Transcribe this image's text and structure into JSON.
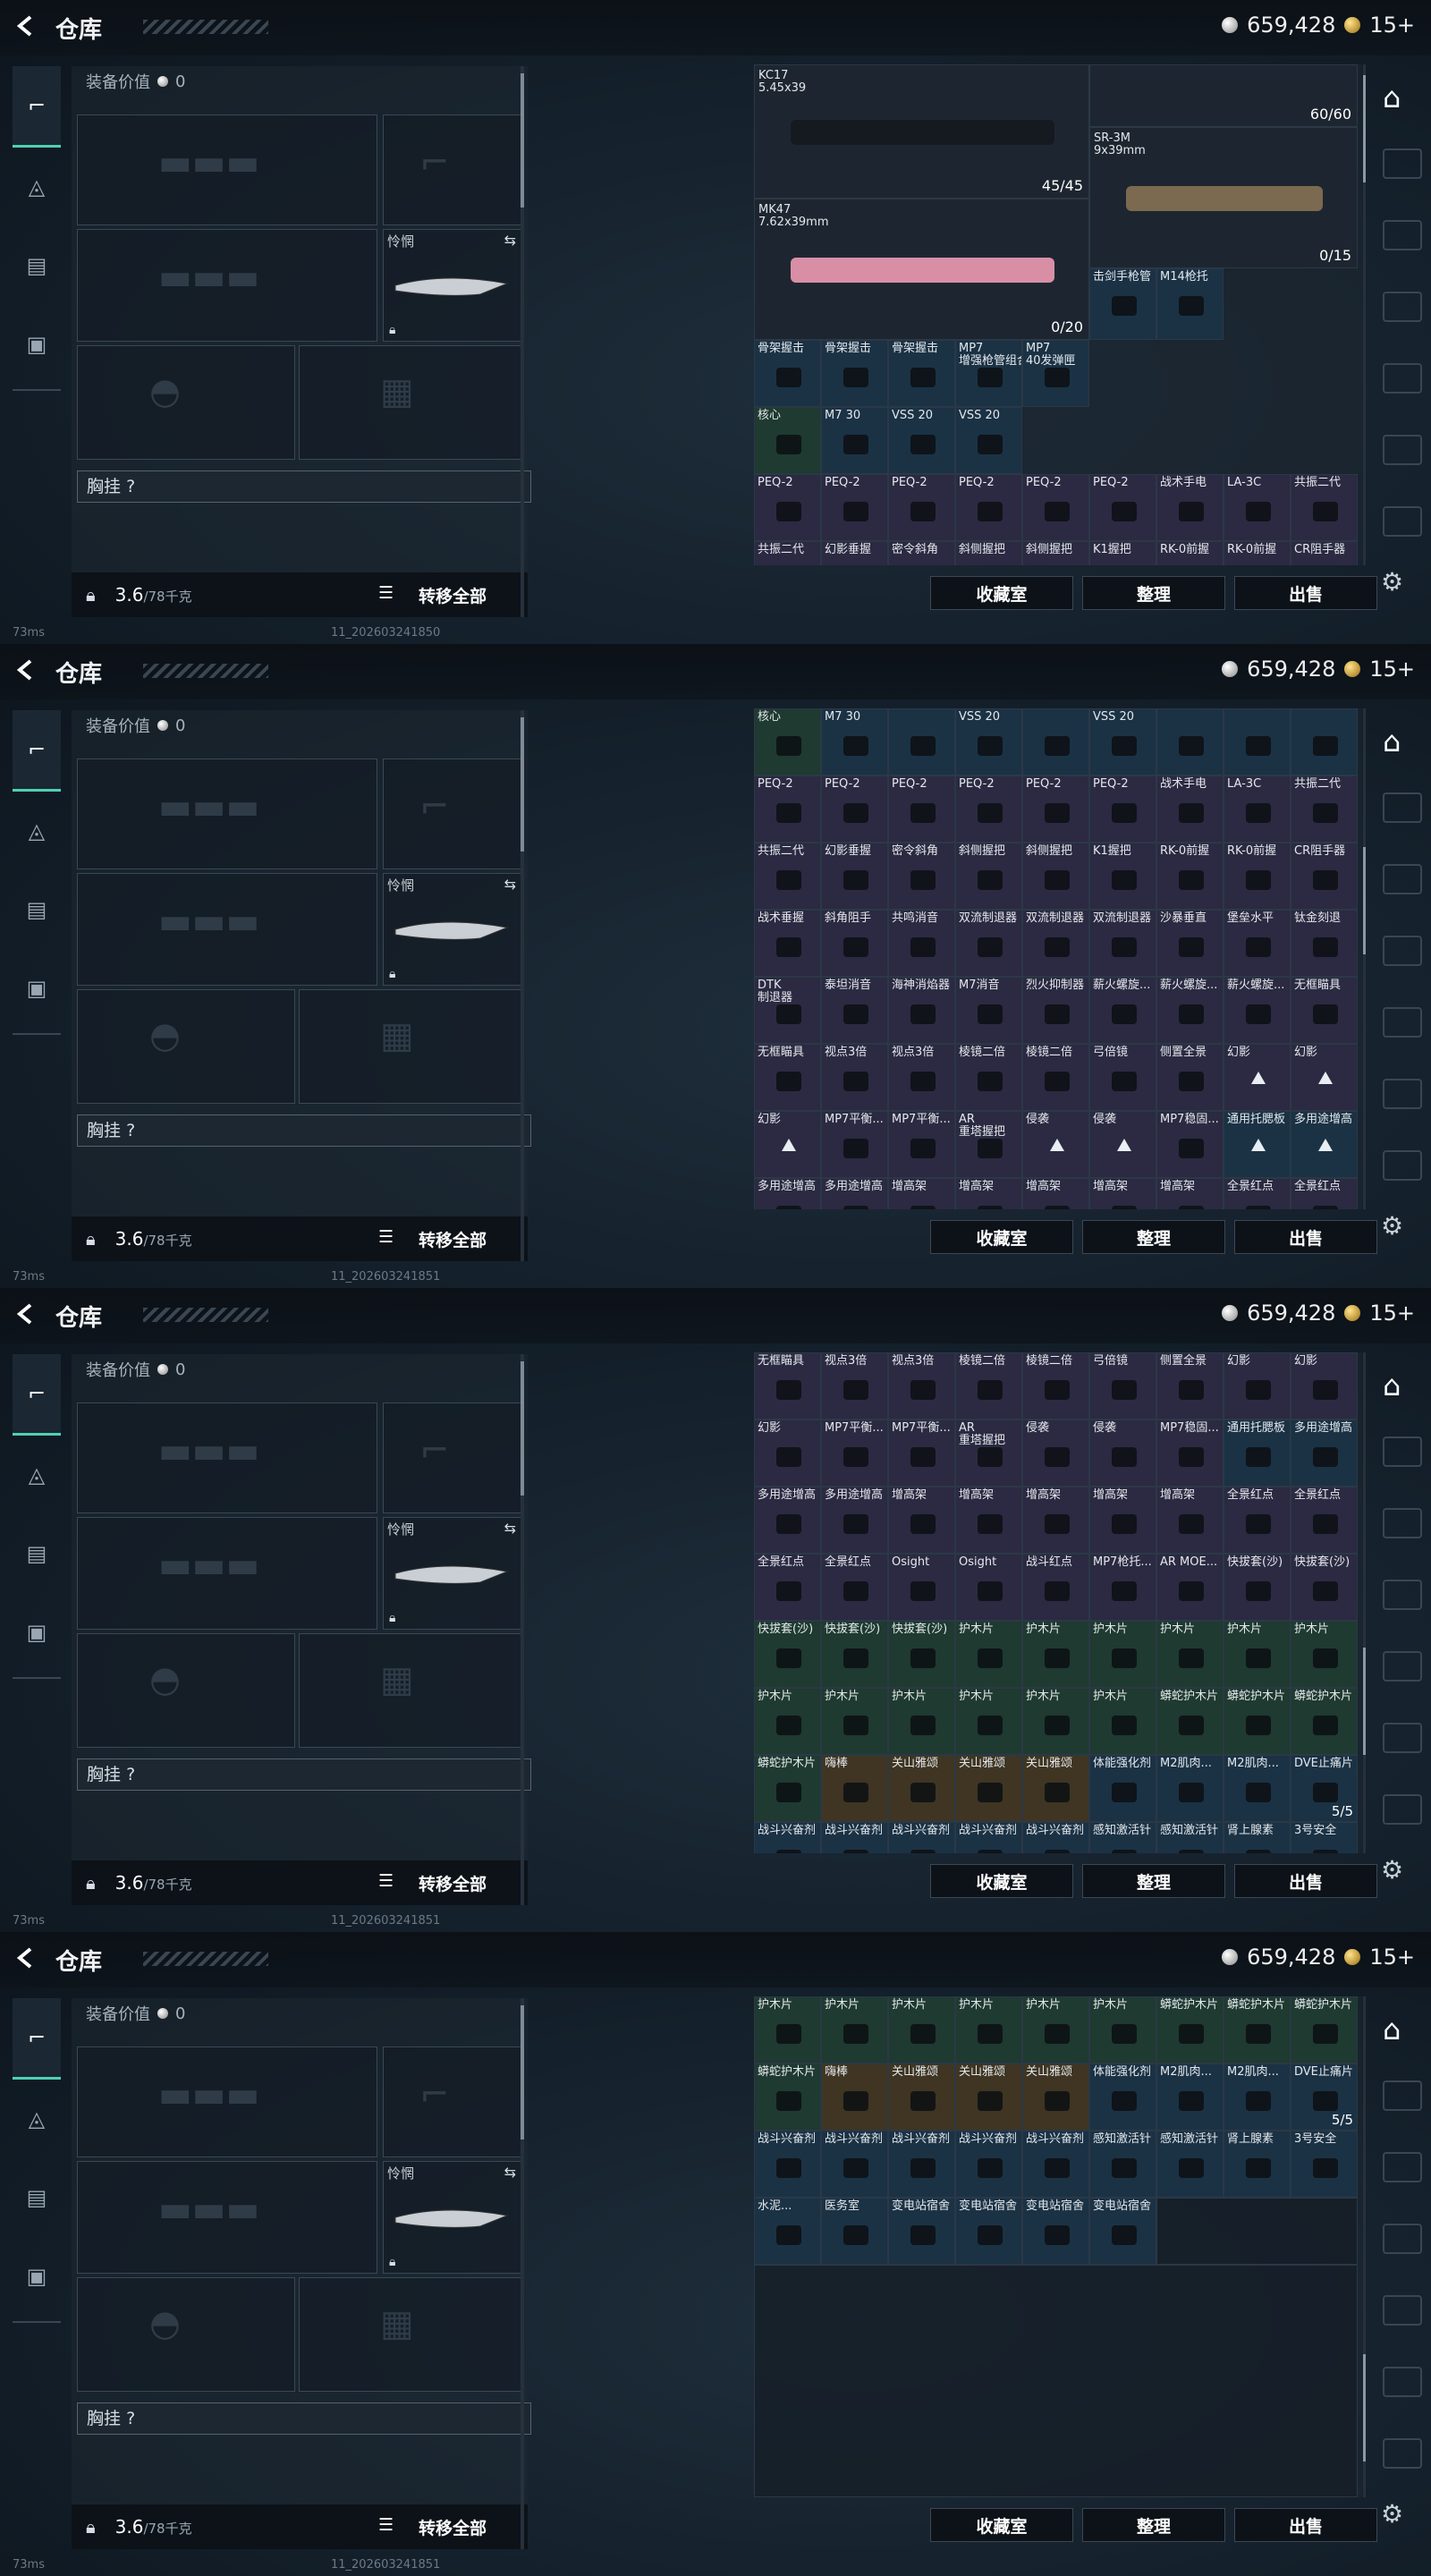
{
  "header": {
    "title": "仓库",
    "silver": "659,428",
    "gold": "15+"
  },
  "equipment": {
    "value_label": "装备价值",
    "value": "0",
    "melee_label": "怜惘",
    "chest_label": "胸挂",
    "chest_hint": "?",
    "weight": "3.6",
    "weight_max": "/78千克",
    "transfer_all": "转移全部"
  },
  "actions": {
    "collection": "收藏室",
    "sort": "整理",
    "sell": "出售"
  },
  "status": {
    "ping": "73ms",
    "build1": "11_202603241850",
    "build2": "11_202603241851"
  },
  "panel1": {
    "weapons": {
      "kc17": {
        "name": "KC17",
        "caliber": "5.45x39",
        "ammo": "45/45"
      },
      "mk47": {
        "name": "MK47",
        "caliber": "7.62x39mm",
        "ammo": "0/20"
      },
      "sr3m": {
        "name": "SR-3M",
        "caliber": "9x39mm",
        "ammo": "0/15"
      },
      "grenade": {
        "ammo": "60/60"
      }
    },
    "rows": [
      [
        {
          "n": "击剑手枪管",
          "c": "b"
        },
        {
          "n": "M14枪托",
          "c": "b"
        }
      ],
      [
        {
          "n": "骨架握击",
          "c": "b"
        },
        {
          "n": "骨架握击",
          "c": "b"
        },
        {
          "n": "骨架握击",
          "c": "b"
        },
        {
          "n": "MP7\n增强枪管组合",
          "c": "b"
        },
        {
          "n": "MP7\n40发弹匣",
          "c": "b"
        }
      ],
      [
        {
          "n": "核心",
          "c": "g"
        },
        {
          "n": "M7 30",
          "c": "b"
        },
        {
          "n": "VSS 20",
          "c": "b"
        },
        {
          "n": "VSS 20",
          "c": "b"
        }
      ],
      [
        {
          "n": "PEQ-2",
          "c": "p"
        },
        {
          "n": "PEQ-2",
          "c": "p"
        },
        {
          "n": "PEQ-2",
          "c": "p"
        },
        {
          "n": "PEQ-2",
          "c": "p"
        },
        {
          "n": "PEQ-2",
          "c": "p"
        },
        {
          "n": "PEQ-2",
          "c": "p"
        },
        {
          "n": "战术手电",
          "c": "p"
        },
        {
          "n": "LA-3C",
          "c": "p"
        },
        {
          "n": "共振二代",
          "c": "p"
        }
      ],
      [
        {
          "n": "共振二代",
          "c": "p"
        },
        {
          "n": "幻影垂握",
          "c": "p"
        },
        {
          "n": "密令斜角",
          "c": "p"
        },
        {
          "n": "斜侧握把",
          "c": "p"
        },
        {
          "n": "斜侧握把",
          "c": "p"
        },
        {
          "n": "K1握把",
          "c": "p"
        },
        {
          "n": "RK-0前握",
          "c": "p"
        },
        {
          "n": "RK-0前握",
          "c": "p"
        },
        {
          "n": "CR阻手器",
          "c": "p"
        }
      ]
    ]
  },
  "panel2": {
    "rows": [
      [
        {
          "n": "核心",
          "c": "g"
        },
        {
          "n": "M7 30",
          "c": "b"
        },
        {
          "n": "",
          "c": "b"
        },
        {
          "n": "VSS 20",
          "c": "b"
        },
        {
          "n": "",
          "c": "b"
        },
        {
          "n": "VSS 20",
          "c": "b"
        },
        {
          "n": "",
          "c": "b"
        },
        {
          "n": "",
          "c": "b"
        },
        {
          "n": "",
          "c": "b"
        }
      ],
      [
        {
          "n": "PEQ-2",
          "c": "p"
        },
        {
          "n": "PEQ-2",
          "c": "p"
        },
        {
          "n": "PEQ-2",
          "c": "p"
        },
        {
          "n": "PEQ-2",
          "c": "p"
        },
        {
          "n": "PEQ-2",
          "c": "p"
        },
        {
          "n": "PEQ-2",
          "c": "p"
        },
        {
          "n": "战术手电",
          "c": "p"
        },
        {
          "n": "LA-3C",
          "c": "p"
        },
        {
          "n": "共振二代",
          "c": "p"
        }
      ],
      [
        {
          "n": "共振二代",
          "c": "p"
        },
        {
          "n": "幻影垂握",
          "c": "p"
        },
        {
          "n": "密令斜角",
          "c": "p"
        },
        {
          "n": "斜侧握把",
          "c": "p"
        },
        {
          "n": "斜侧握把",
          "c": "p"
        },
        {
          "n": "K1握把",
          "c": "p"
        },
        {
          "n": "RK-0前握",
          "c": "p"
        },
        {
          "n": "RK-0前握",
          "c": "p"
        },
        {
          "n": "CR阻手器",
          "c": "p"
        }
      ],
      [
        {
          "n": "战术垂握",
          "c": "p"
        },
        {
          "n": "斜角阻手",
          "c": "p"
        },
        {
          "n": "共鸣消音",
          "c": "p"
        },
        {
          "n": "双流制退器",
          "c": "p"
        },
        {
          "n": "双流制退器",
          "c": "p"
        },
        {
          "n": "双流制退器",
          "c": "p"
        },
        {
          "n": "沙暴垂直",
          "c": "p"
        },
        {
          "n": "堡垒水平",
          "c": "p"
        },
        {
          "n": "钛金刻退",
          "c": "p"
        }
      ],
      [
        {
          "n": "DTK\n制退器",
          "c": "p"
        },
        {
          "n": "泰坦消音",
          "c": "p"
        },
        {
          "n": "海神消焰器",
          "c": "p"
        },
        {
          "n": "M7消音",
          "c": "p"
        },
        {
          "n": "烈火抑制器",
          "c": "p"
        },
        {
          "n": "薪火螺旋...",
          "c": "p"
        },
        {
          "n": "薪火螺旋...",
          "c": "p"
        },
        {
          "n": "薪火螺旋...",
          "c": "p"
        },
        {
          "n": "无框瞄具",
          "c": "p"
        }
      ],
      [
        {
          "n": "无框瞄具",
          "c": "p"
        },
        {
          "n": "视点3倍",
          "c": "p"
        },
        {
          "n": "视点3倍",
          "c": "p"
        },
        {
          "n": "棱镜二倍",
          "c": "p"
        },
        {
          "n": "棱镜二倍",
          "c": "p"
        },
        {
          "n": "弓倍镜",
          "c": "p"
        },
        {
          "n": "侧置全景",
          "c": "p"
        },
        {
          "n": "幻影",
          "c": "p",
          "t": 1
        },
        {
          "n": "幻影",
          "c": "p",
          "t": 1
        }
      ],
      [
        {
          "n": "幻影",
          "c": "p",
          "t": 1
        },
        {
          "n": "MP7平衡...",
          "c": "p"
        },
        {
          "n": "MP7平衡...",
          "c": "p"
        },
        {
          "n": "AR\n重塔握把",
          "c": "p"
        },
        {
          "n": "侵袭",
          "c": "p",
          "t": 1
        },
        {
          "n": "侵袭",
          "c": "p",
          "t": 1
        },
        {
          "n": "MP7稳固...",
          "c": "p"
        },
        {
          "n": "通用托腮板",
          "c": "b",
          "t": 1
        },
        {
          "n": "多用途增高",
          "c": "b",
          "t": 1
        }
      ],
      [
        {
          "n": "多用途增高",
          "c": "p"
        },
        {
          "n": "多用途增高",
          "c": "p"
        },
        {
          "n": "增高架",
          "c": "p"
        },
        {
          "n": "增高架",
          "c": "p"
        },
        {
          "n": "增高架",
          "c": "p"
        },
        {
          "n": "增高架",
          "c": "p"
        },
        {
          "n": "增高架",
          "c": "p"
        },
        {
          "n": "全景红点",
          "c": "p"
        },
        {
          "n": "全景红点",
          "c": "p"
        }
      ]
    ]
  },
  "panel3": {
    "rows": [
      [
        {
          "n": "无框瞄具",
          "c": "p"
        },
        {
          "n": "视点3倍",
          "c": "p"
        },
        {
          "n": "视点3倍",
          "c": "p"
        },
        {
          "n": "棱镜二倍",
          "c": "p"
        },
        {
          "n": "棱镜二倍",
          "c": "p"
        },
        {
          "n": "弓倍镜",
          "c": "p"
        },
        {
          "n": "侧置全景",
          "c": "p"
        },
        {
          "n": "幻影",
          "c": "p"
        },
        {
          "n": "幻影",
          "c": "p"
        }
      ],
      [
        {
          "n": "幻影",
          "c": "p"
        },
        {
          "n": "MP7平衡...",
          "c": "p"
        },
        {
          "n": "MP7平衡...",
          "c": "p"
        },
        {
          "n": "AR\n重塔握把",
          "c": "p"
        },
        {
          "n": "侵袭",
          "c": "p"
        },
        {
          "n": "侵袭",
          "c": "p"
        },
        {
          "n": "MP7稳固...",
          "c": "p"
        },
        {
          "n": "通用托腮板",
          "c": "b"
        },
        {
          "n": "多用途增高",
          "c": "b"
        }
      ],
      [
        {
          "n": "多用途增高",
          "c": "p"
        },
        {
          "n": "多用途增高",
          "c": "p"
        },
        {
          "n": "增高架",
          "c": "p"
        },
        {
          "n": "增高架",
          "c": "p"
        },
        {
          "n": "增高架",
          "c": "p"
        },
        {
          "n": "增高架",
          "c": "p"
        },
        {
          "n": "增高架",
          "c": "p"
        },
        {
          "n": "全景红点",
          "c": "p"
        },
        {
          "n": "全景红点",
          "c": "p"
        }
      ],
      [
        {
          "n": "全景红点",
          "c": "p"
        },
        {
          "n": "全景红点",
          "c": "p"
        },
        {
          "n": "Osight",
          "c": "p"
        },
        {
          "n": "Osight",
          "c": "p"
        },
        {
          "n": "战斗红点",
          "c": "p"
        },
        {
          "n": "MP7枪托...",
          "c": "p"
        },
        {
          "n": "AR MOE...",
          "c": "p"
        },
        {
          "n": "快拔套(沙)",
          "c": "p"
        },
        {
          "n": "快拔套(沙)",
          "c": "p"
        }
      ],
      [
        {
          "n": "快拔套(沙)",
          "c": "g"
        },
        {
          "n": "快拔套(沙)",
          "c": "g"
        },
        {
          "n": "快拔套(沙)",
          "c": "g"
        },
        {
          "n": "护木片",
          "c": "g"
        },
        {
          "n": "护木片",
          "c": "g"
        },
        {
          "n": "护木片",
          "c": "g"
        },
        {
          "n": "护木片",
          "c": "g"
        },
        {
          "n": "护木片",
          "c": "g"
        },
        {
          "n": "护木片",
          "c": "g"
        }
      ],
      [
        {
          "n": "护木片",
          "c": "g"
        },
        {
          "n": "护木片",
          "c": "g"
        },
        {
          "n": "护木片",
          "c": "g"
        },
        {
          "n": "护木片",
          "c": "g"
        },
        {
          "n": "护木片",
          "c": "g"
        },
        {
          "n": "护木片",
          "c": "g"
        },
        {
          "n": "蟒蛇护木片",
          "c": "g"
        },
        {
          "n": "蟒蛇护木片",
          "c": "g"
        },
        {
          "n": "蟒蛇护木片",
          "c": "g"
        }
      ],
      [
        {
          "n": "蟒蛇护木片",
          "c": "g"
        },
        {
          "n": "嗨棒",
          "c": "y"
        },
        {
          "n": "关山雅颂",
          "c": "y"
        },
        {
          "n": "关山雅颂",
          "c": "y"
        },
        {
          "n": "关山雅颂",
          "c": "y"
        },
        {
          "n": "体能强化剂",
          "c": "b"
        },
        {
          "n": "M2肌肉...",
          "c": "b"
        },
        {
          "n": "M2肌肉...",
          "c": "b"
        },
        {
          "n": "DVE止痛片",
          "c": "b",
          "q": "5/5"
        }
      ],
      [
        {
          "n": "战斗兴奋剂",
          "c": "b"
        },
        {
          "n": "战斗兴奋剂",
          "c": "b"
        },
        {
          "n": "战斗兴奋剂",
          "c": "b"
        },
        {
          "n": "战斗兴奋剂",
          "c": "b"
        },
        {
          "n": "战斗兴奋剂",
          "c": "b"
        },
        {
          "n": "感知激活针",
          "c": "b"
        },
        {
          "n": "感知激活针",
          "c": "b"
        },
        {
          "n": "肾上腺素",
          "c": "b"
        },
        {
          "n": "3号安全",
          "c": "b"
        }
      ]
    ]
  },
  "panel4": {
    "rows": [
      [
        {
          "n": "护木片",
          "c": "g"
        },
        {
          "n": "护木片",
          "c": "g"
        },
        {
          "n": "护木片",
          "c": "g"
        },
        {
          "n": "护木片",
          "c": "g"
        },
        {
          "n": "护木片",
          "c": "g"
        },
        {
          "n": "护木片",
          "c": "g"
        },
        {
          "n": "蟒蛇护木片",
          "c": "g"
        },
        {
          "n": "蟒蛇护木片",
          "c": "g"
        },
        {
          "n": "蟒蛇护木片",
          "c": "g"
        }
      ],
      [
        {
          "n": "蟒蛇护木片",
          "c": "g"
        },
        {
          "n": "嗨棒",
          "c": "y"
        },
        {
          "n": "关山雅颂",
          "c": "y"
        },
        {
          "n": "关山雅颂",
          "c": "y"
        },
        {
          "n": "关山雅颂",
          "c": "y"
        },
        {
          "n": "体能强化剂",
          "c": "b"
        },
        {
          "n": "M2肌肉...",
          "c": "b"
        },
        {
          "n": "M2肌肉...",
          "c": "b"
        },
        {
          "n": "DVE止痛片",
          "c": "b",
          "q": "5/5"
        }
      ],
      [
        {
          "n": "战斗兴奋剂",
          "c": "b"
        },
        {
          "n": "战斗兴奋剂",
          "c": "b"
        },
        {
          "n": "战斗兴奋剂",
          "c": "b"
        },
        {
          "n": "战斗兴奋剂",
          "c": "b"
        },
        {
          "n": "战斗兴奋剂",
          "c": "b"
        },
        {
          "n": "感知激活针",
          "c": "b"
        },
        {
          "n": "感知激活针",
          "c": "b"
        },
        {
          "n": "肾上腺素",
          "c": "b"
        },
        {
          "n": "3号安全",
          "c": "b"
        }
      ],
      [
        {
          "n": "水泥...",
          "c": "b"
        },
        {
          "n": "医务室",
          "c": "b"
        },
        {
          "n": "变电站宿舍",
          "c": "b"
        },
        {
          "n": "变电站宿舍",
          "c": "b"
        },
        {
          "n": "变电站宿舍",
          "c": "b"
        },
        {
          "n": "变电站宿舍",
          "c": "b"
        }
      ]
    ]
  },
  "icons": {
    "back": "back-arrow-icon",
    "pistol": "pistol-icon",
    "helmet": "helmet-icon",
    "vest": "vest-icon",
    "briefcase": "briefcase-icon",
    "gear": "gear-icon",
    "lock": "lock-icon",
    "list": "list-icon"
  }
}
